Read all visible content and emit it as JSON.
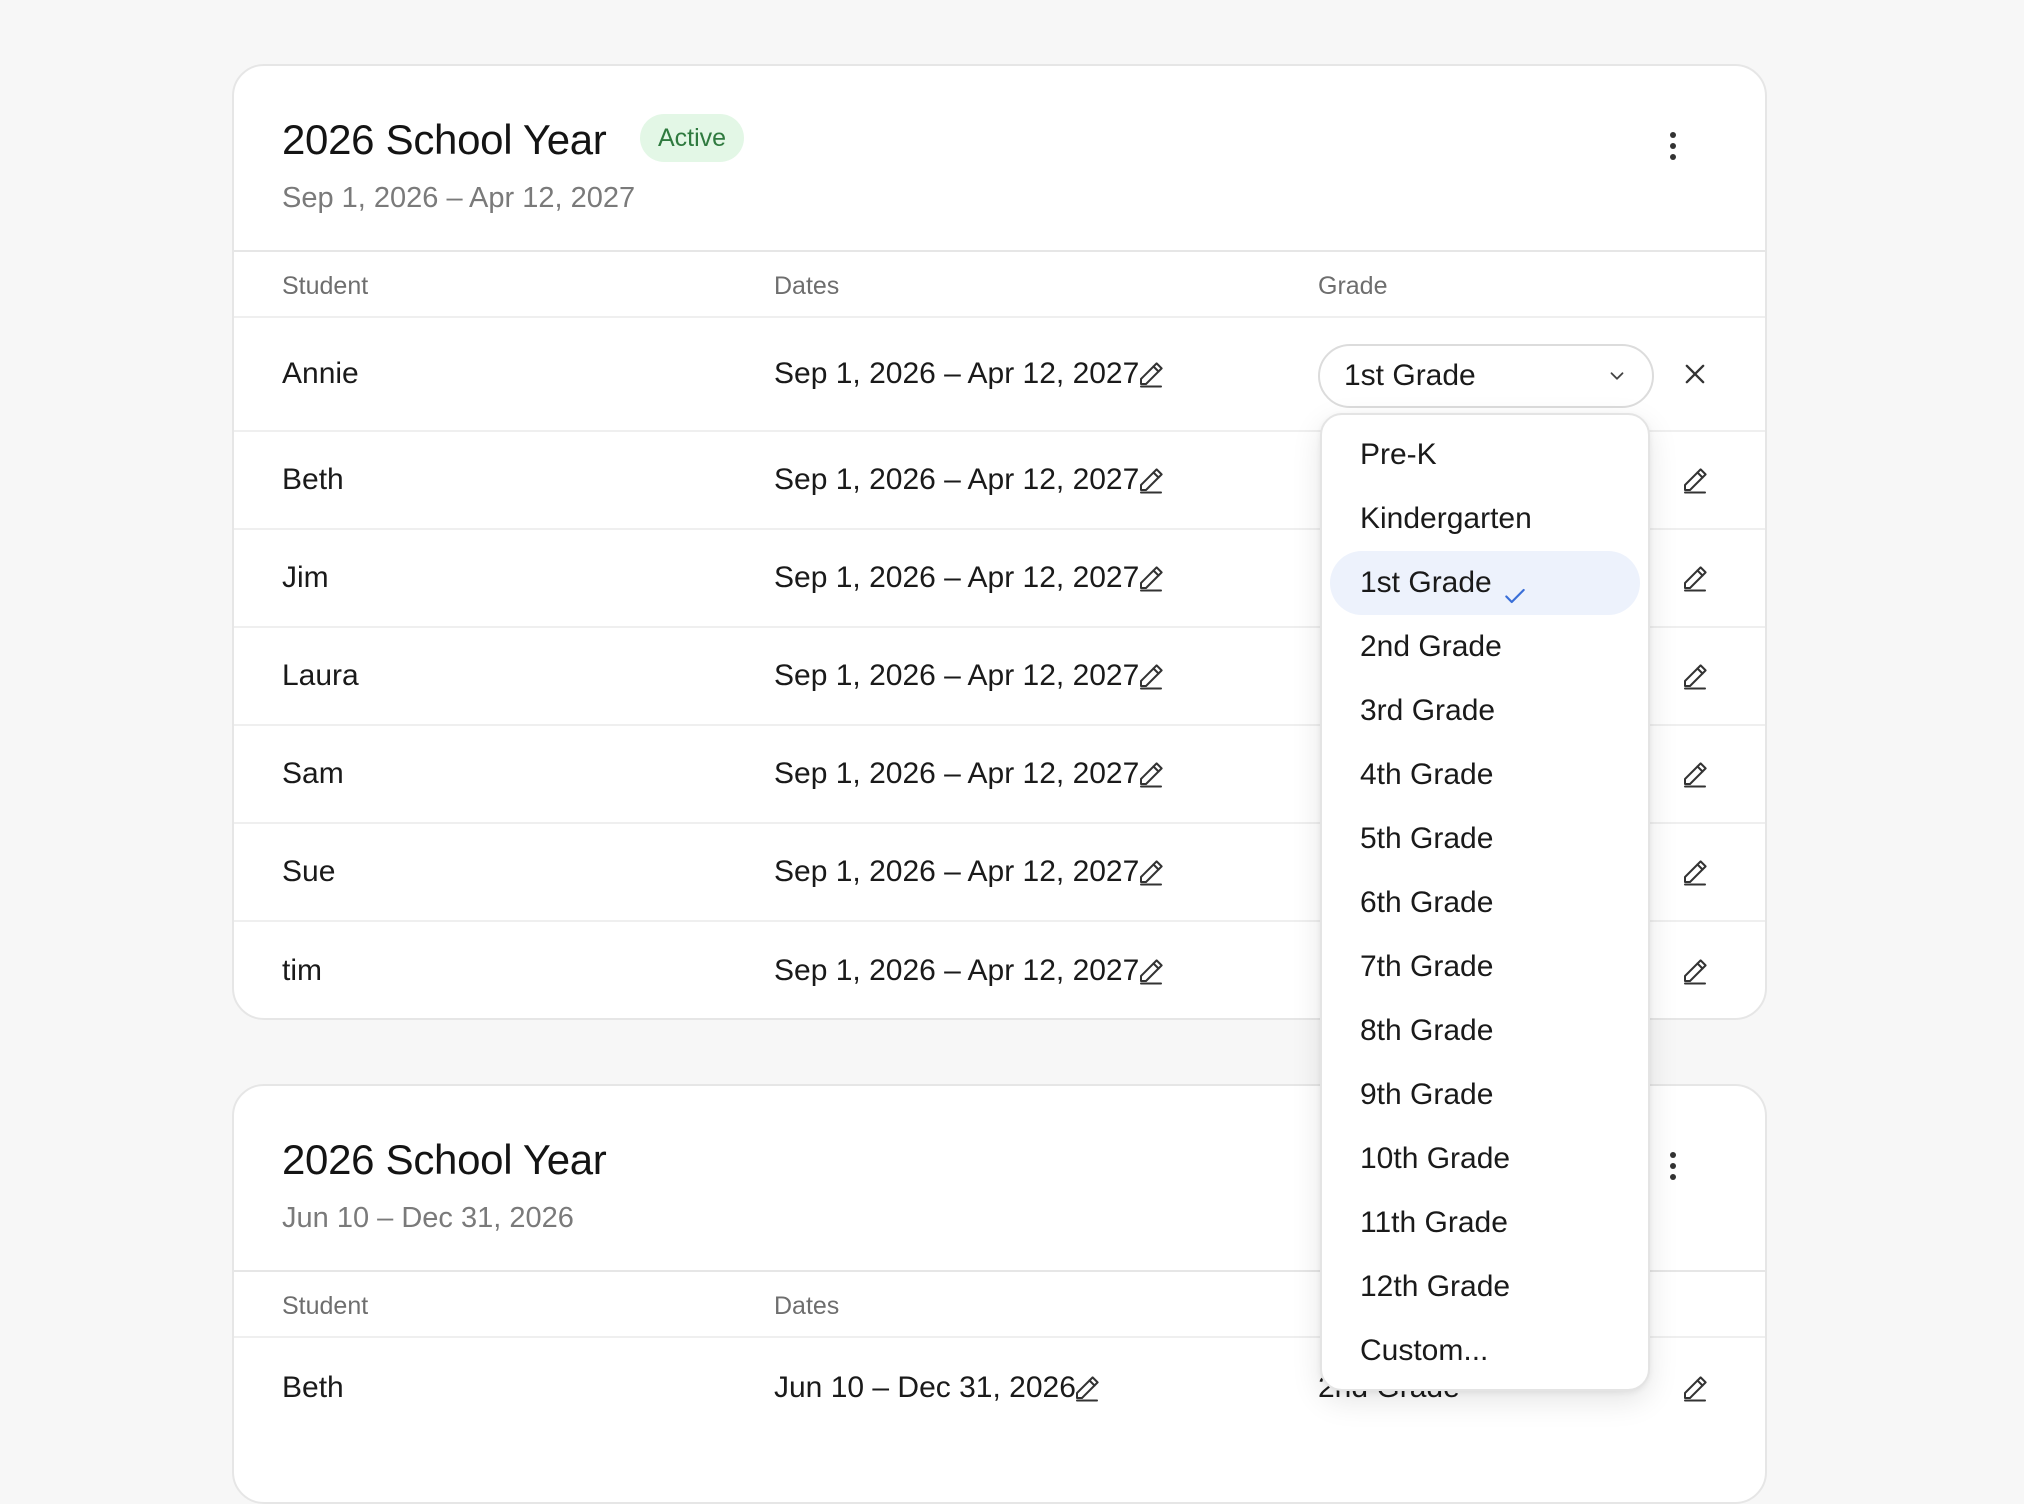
{
  "card1": {
    "title": "2026 School Year",
    "badge": "Active",
    "range": "Sep 1, 2026 – Apr 12, 2027",
    "columns": {
      "student": "Student",
      "dates": "Dates",
      "grade": "Grade"
    },
    "rows": [
      {
        "name": "Annie",
        "dates": "Sep 1, 2026 – Apr 12, 2027",
        "grade": "1st Grade"
      },
      {
        "name": "Beth",
        "dates": "Sep 1, 2026 – Apr 12, 2027"
      },
      {
        "name": "Jim",
        "dates": "Sep 1, 2026 – Apr 12, 2027"
      },
      {
        "name": "Laura",
        "dates": "Sep 1, 2026 – Apr 12, 2027"
      },
      {
        "name": "Sam",
        "dates": "Sep 1, 2026 – Apr 12, 2027"
      },
      {
        "name": "Sue",
        "dates": "Sep 1, 2026 – Apr 12, 2027"
      },
      {
        "name": "tim",
        "dates": "Sep 1, 2026 – Apr 12, 2027"
      }
    ]
  },
  "card2": {
    "title": "2026 School Year",
    "range": "Jun 10 – Dec 31, 2026",
    "columns": {
      "student": "Student",
      "dates": "Dates"
    },
    "rows": [
      {
        "name": "Beth",
        "dates": "Jun 10 – Dec 31, 2026",
        "grade": "2nd Grade"
      }
    ]
  },
  "dropdown": {
    "selected": "1st Grade",
    "options": [
      "Pre-K",
      "Kindergarten",
      "1st Grade",
      "2nd Grade",
      "3rd Grade",
      "4th Grade",
      "5th Grade",
      "6th Grade",
      "7th Grade",
      "8th Grade",
      "9th Grade",
      "10th Grade",
      "11th Grade",
      "12th Grade",
      "Custom..."
    ]
  },
  "colors": {
    "badge_bg": "#e3f7e6",
    "badge_text": "#2f7a3f",
    "selected_option_bg": "#edf2fc",
    "check": "#3a6fd8"
  }
}
